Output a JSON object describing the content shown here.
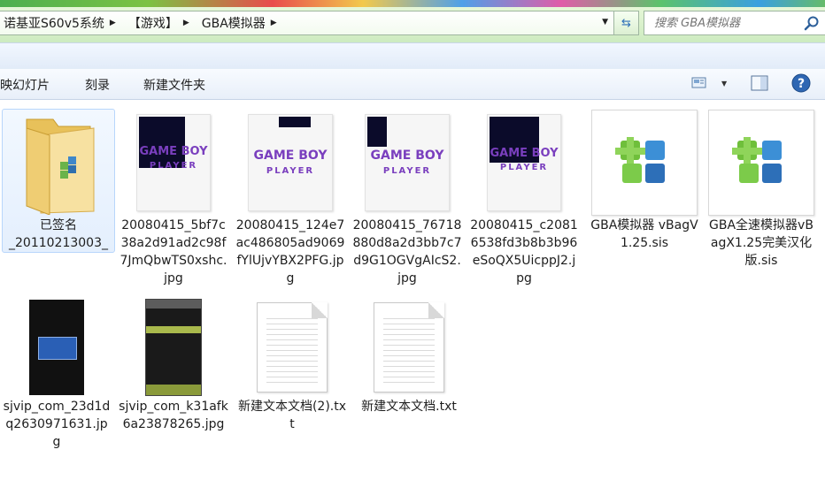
{
  "address": {
    "crumbs": [
      "诺基亚S60v5系统",
      "【游戏】",
      "GBA模拟器"
    ]
  },
  "search": {
    "placeholder": "搜索 GBA模拟器"
  },
  "toolbar": {
    "slideshow_label": "映幻灯片",
    "burn_label": "刻录",
    "new_folder_label": "新建文件夹"
  },
  "files": [
    {
      "name": "已签名\n_20110213003_",
      "kind": "folder"
    },
    {
      "name": "20080415_5bf7c38a2d91ad2c98f7JmQbwTS0xshc.jpg",
      "kind": "gameboy-photo"
    },
    {
      "name": "20080415_124e7ac486805ad9069fYlUjvYBX2PFG.jpg",
      "kind": "gameboy-photo"
    },
    {
      "name": "20080415_76718880d8a2d3bb7c7d9G1OGVgAIcS2.jpg",
      "kind": "gameboy-photo"
    },
    {
      "name": "20080415_c20816538fd3b8b3b96eSoQX5UicppJ2.jpg",
      "kind": "gameboy-photo"
    },
    {
      "name": "GBA模拟器 vBagV1.25.sis",
      "kind": "sis"
    },
    {
      "name": "GBA全速模拟器vBagX1.25完美汉化版.sis",
      "kind": "sis"
    },
    {
      "name": "sjvip_com_23d1dq2630971631.jpg",
      "kind": "phone-photo"
    },
    {
      "name": "sjvip_com_k31afk6a23878265.jpg",
      "kind": "phone-menu-photo"
    },
    {
      "name": "新建文本文档(2).txt",
      "kind": "txt"
    },
    {
      "name": "新建文本文档.txt",
      "kind": "txt"
    }
  ],
  "thumb_text": {
    "game": "GAME BOY",
    "player": "PLAYER"
  },
  "colors": {
    "accent_blue": "#2d6fb8",
    "gameboy_purple": "#7a3fbe",
    "selection": "#b8d6fb"
  }
}
